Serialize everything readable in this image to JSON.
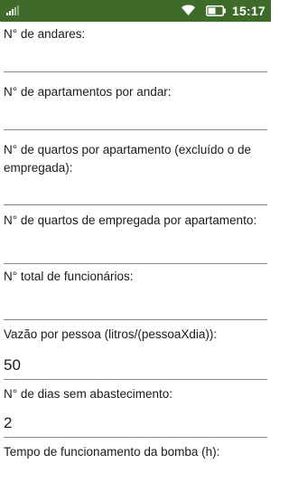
{
  "status_bar": {
    "time": "15:17",
    "bg_color": "#3f6b2a",
    "icons": [
      "signal-icon",
      "wifi-icon",
      "battery-icon"
    ]
  },
  "form": {
    "fields": [
      {
        "label": "N° de andares:",
        "value": ""
      },
      {
        "label": "N° de apartamentos por andar:",
        "value": ""
      },
      {
        "label": "N° de quartos por apartamento (excluído o de empregada):",
        "value": ""
      },
      {
        "label": "N° de quartos de empregada por apartamento:",
        "value": ""
      },
      {
        "label": "N° total de funcionários:",
        "value": ""
      },
      {
        "label": "Vazão por pessoa (litros/(pessoaXdia)):",
        "value": "50"
      },
      {
        "label": "N° de dias sem abastecimento:",
        "value": "2"
      },
      {
        "label": "Tempo de funcionamento da bomba (h):",
        "value": ""
      }
    ]
  }
}
